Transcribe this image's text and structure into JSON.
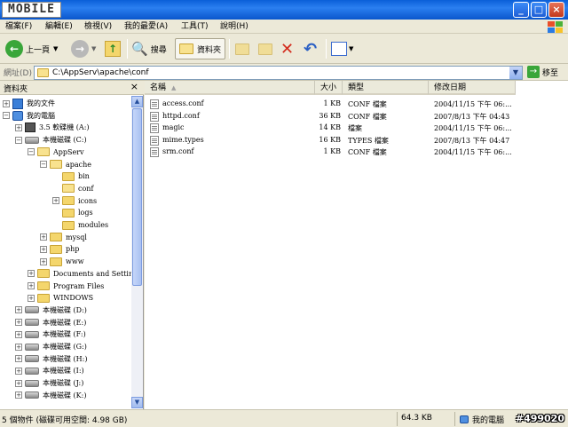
{
  "title_logo": "MOBILE",
  "menu": [
    "檔案(F)",
    "編輯(E)",
    "檢視(V)",
    "我的最愛(A)",
    "工具(T)",
    "說明(H)"
  ],
  "toolbar": {
    "back_label": "上一頁",
    "search_label": "搜尋",
    "folders_label": "資料夾"
  },
  "address": {
    "label": "網址(D)",
    "path": "C:\\AppServ\\apache\\conf",
    "go_label": "移至"
  },
  "folders_pane": {
    "title": "資料夾",
    "tree": [
      {
        "label": "我的文件",
        "icon": "documents-icon",
        "depth": 0,
        "toggle": "+"
      },
      {
        "label": "我的電腦",
        "icon": "computer-icon",
        "depth": 0,
        "toggle": "-"
      },
      {
        "label": "3.5 軟碟機 (A:)",
        "icon": "floppy-icon",
        "depth": 1,
        "toggle": "+"
      },
      {
        "label": "本機磁碟 (C:)",
        "icon": "drive-icon",
        "depth": 1,
        "toggle": "-"
      },
      {
        "label": "AppServ",
        "icon": "folder-open-icon",
        "depth": 2,
        "toggle": "-"
      },
      {
        "label": "apache",
        "icon": "folder-open-icon",
        "depth": 3,
        "toggle": "-"
      },
      {
        "label": "bin",
        "icon": "folder-icon",
        "depth": 4,
        "toggle": ""
      },
      {
        "label": "conf",
        "icon": "folder-open-icon",
        "depth": 4,
        "toggle": ""
      },
      {
        "label": "icons",
        "icon": "folder-icon",
        "depth": 4,
        "toggle": "+"
      },
      {
        "label": "logs",
        "icon": "folder-icon",
        "depth": 4,
        "toggle": ""
      },
      {
        "label": "modules",
        "icon": "folder-icon",
        "depth": 4,
        "toggle": ""
      },
      {
        "label": "mysql",
        "icon": "folder-icon",
        "depth": 3,
        "toggle": "+"
      },
      {
        "label": "php",
        "icon": "folder-icon",
        "depth": 3,
        "toggle": "+"
      },
      {
        "label": "www",
        "icon": "folder-icon",
        "depth": 3,
        "toggle": "+"
      },
      {
        "label": "Documents and Setting",
        "icon": "folder-icon",
        "depth": 2,
        "toggle": "+"
      },
      {
        "label": "Program Files",
        "icon": "folder-icon",
        "depth": 2,
        "toggle": "+"
      },
      {
        "label": "WINDOWS",
        "icon": "folder-icon",
        "depth": 2,
        "toggle": "+"
      },
      {
        "label": "本機磁碟 (D:)",
        "icon": "drive-icon",
        "depth": 1,
        "toggle": "+"
      },
      {
        "label": "本機磁碟 (E:)",
        "icon": "drive-icon",
        "depth": 1,
        "toggle": "+"
      },
      {
        "label": "本機磁碟 (F:)",
        "icon": "drive-icon",
        "depth": 1,
        "toggle": "+"
      },
      {
        "label": "本機磁碟 (G:)",
        "icon": "drive-icon",
        "depth": 1,
        "toggle": "+"
      },
      {
        "label": "本機磁碟 (H:)",
        "icon": "drive-icon",
        "depth": 1,
        "toggle": "+"
      },
      {
        "label": "本機磁碟 (I:)",
        "icon": "drive-icon",
        "depth": 1,
        "toggle": "+"
      },
      {
        "label": "本機磁碟 (J:)",
        "icon": "drive-icon",
        "depth": 1,
        "toggle": "+"
      },
      {
        "label": "本機磁碟 (K:)",
        "icon": "drive-icon",
        "depth": 1,
        "toggle": "+"
      }
    ]
  },
  "columns": [
    "名稱",
    "大小",
    "類型",
    "修改日期"
  ],
  "files": [
    {
      "name": "access.conf",
      "size": "1 KB",
      "type": "CONF 檔案",
      "modified": "2004/11/15 下午 06:..."
    },
    {
      "name": "httpd.conf",
      "size": "36 KB",
      "type": "CONF 檔案",
      "modified": "2007/8/13 下午 04:43"
    },
    {
      "name": "magic",
      "size": "14 KB",
      "type": "檔案",
      "modified": "2004/11/15 下午 06:..."
    },
    {
      "name": "mime.types",
      "size": "16 KB",
      "type": "TYPES 檔案",
      "modified": "2007/8/13 下午 04:47"
    },
    {
      "name": "srm.conf",
      "size": "1 KB",
      "type": "CONF 檔案",
      "modified": "2004/11/15 下午 06:..."
    }
  ],
  "status": {
    "objects": "5 個物件 (磁碟可用空間: 4.98 GB)",
    "size": "64.3 KB",
    "location": "我的電腦",
    "watermark": "#499020"
  },
  "colors": {
    "titlebar": "#0a5fd8",
    "chrome": "#ece9d8",
    "close": "#c3391c"
  }
}
